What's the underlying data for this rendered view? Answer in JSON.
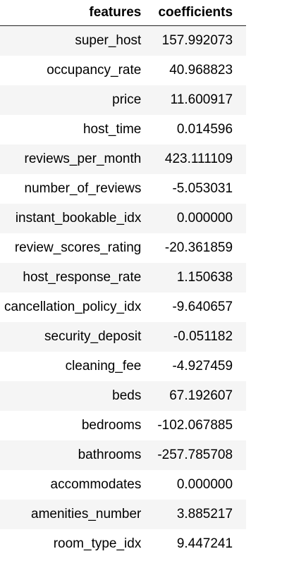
{
  "table": {
    "columns": [
      "features",
      "coefficients"
    ],
    "rows": [
      [
        "super_host",
        "157.992073"
      ],
      [
        "occupancy_rate",
        "40.968823"
      ],
      [
        "price",
        "11.600917"
      ],
      [
        "host_time",
        "0.014596"
      ],
      [
        "reviews_per_month",
        "423.111109"
      ],
      [
        "number_of_reviews",
        "-5.053031"
      ],
      [
        "instant_bookable_idx",
        "0.000000"
      ],
      [
        "review_scores_rating",
        "-20.361859"
      ],
      [
        "host_response_rate",
        "1.150638"
      ],
      [
        "cancellation_policy_idx",
        "-9.640657"
      ],
      [
        "security_deposit",
        "-0.051182"
      ],
      [
        "cleaning_fee",
        "-4.927459"
      ],
      [
        "beds",
        "67.192607"
      ],
      [
        "bedrooms",
        "-102.067885"
      ],
      [
        "bathrooms",
        "-257.785708"
      ],
      [
        "accommodates",
        "0.000000"
      ],
      [
        "amenities_number",
        "3.885217"
      ],
      [
        "room_type_idx",
        "9.447241"
      ]
    ]
  }
}
